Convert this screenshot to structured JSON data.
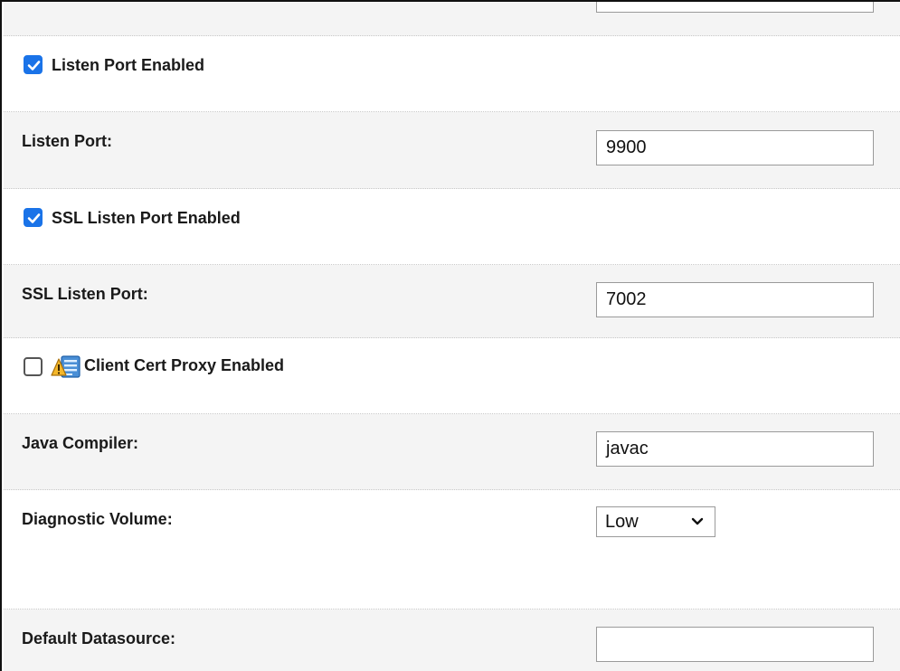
{
  "fields": {
    "listen_port_enabled": {
      "label": "Listen Port Enabled",
      "checked": true
    },
    "listen_port": {
      "label": "Listen Port:",
      "value": "9900"
    },
    "ssl_listen_port_enabled": {
      "label": "SSL Listen Port Enabled",
      "checked": true
    },
    "ssl_listen_port": {
      "label": "SSL Listen Port:",
      "value": "7002"
    },
    "client_cert_proxy_enabled": {
      "label": "Client Cert Proxy Enabled",
      "checked": false,
      "icon": "warning-config-icon"
    },
    "java_compiler": {
      "label": "Java Compiler:",
      "value": "javac"
    },
    "diagnostic_volume": {
      "label": "Diagnostic Volume:",
      "selected": "Low"
    },
    "default_datasource": {
      "label": "Default Datasource:",
      "value": ""
    }
  },
  "colors": {
    "checkbox_accent": "#1a73e8",
    "row_shade": "#f4f4f4",
    "input_border": "#9a9a9a"
  }
}
